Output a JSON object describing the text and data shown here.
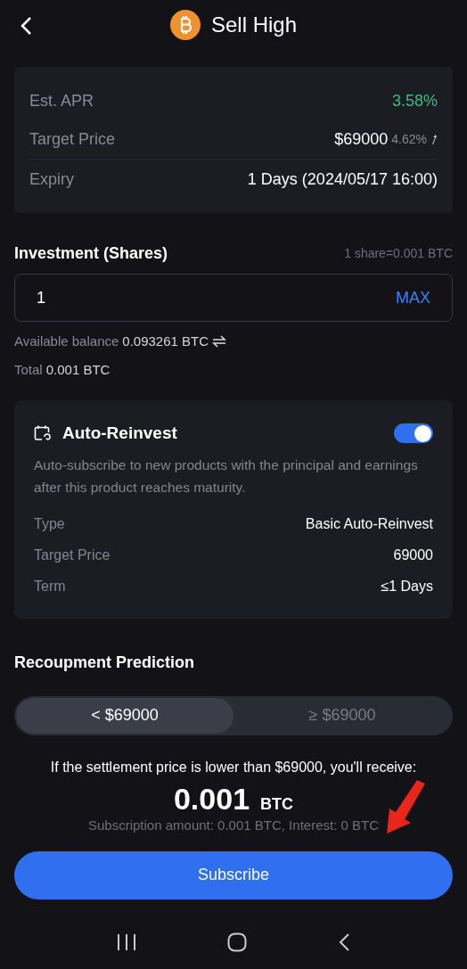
{
  "header": {
    "title": "Sell High"
  },
  "summary": [
    {
      "label": "Est. APR",
      "value": "3.58%",
      "kind": "apr"
    },
    {
      "label": "Target Price",
      "value": "$69000",
      "change": "4.62%",
      "kind": "price"
    },
    {
      "label": "Expiry",
      "value": "1 Days (2024/05/17 16:00)",
      "kind": "plain"
    }
  ],
  "investment": {
    "title": "Investment (Shares)",
    "share_note": "1 share=0.001 BTC",
    "value": "1",
    "max": "MAX",
    "balance_label": "Available balance",
    "balance": "0.093261 BTC",
    "total_label": "Total",
    "total": "0.001 BTC"
  },
  "auto_reinvest": {
    "title": "Auto-Reinvest",
    "on": true,
    "description": "Auto-subscribe to new products with the principal and earnings after this product reaches maturity.",
    "rows": [
      {
        "label": "Type",
        "value": "Basic Auto-Reinvest"
      },
      {
        "label": "Target Price",
        "value": "69000"
      },
      {
        "label": "Term",
        "value": "≤1 Days"
      }
    ]
  },
  "prediction": {
    "title": "Recoupment Prediction",
    "tabs": [
      {
        "label": "< $69000",
        "selected": true
      },
      {
        "label": "≥ $69000",
        "selected": false
      }
    ],
    "sentence": "If the settlement price is lower than $69000, you'll receive:",
    "amount": "0.001",
    "unit": "BTC",
    "detail": "Subscription amount: 0.001 BTC, Interest: 0 BTC"
  },
  "subscribe": "Subscribe"
}
